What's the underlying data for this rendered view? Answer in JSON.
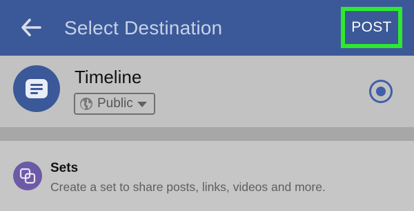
{
  "header": {
    "title": "Select Destination",
    "post_label": "POST",
    "back_icon": "arrow-left-icon",
    "background": "#3b5998",
    "highlight_color": "#2ee830"
  },
  "timeline": {
    "label": "Timeline",
    "icon": "post-text-icon",
    "audience": {
      "label": "Public",
      "icon": "globe-icon"
    },
    "selected": true
  },
  "sets": {
    "title": "Sets",
    "description": "Create a set to share posts, links, videos and more.",
    "icon": "sets-icon",
    "icon_color": "#6d5aa7"
  }
}
